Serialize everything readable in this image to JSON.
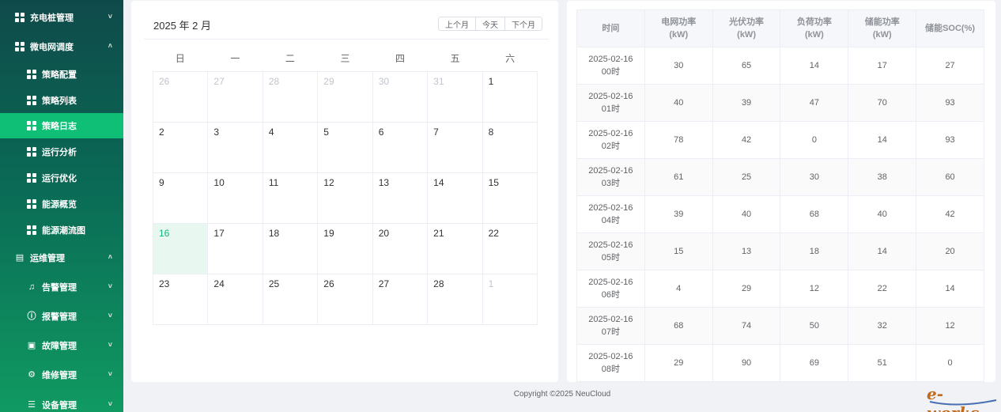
{
  "sidebar": {
    "items": [
      {
        "label": "充电桩管理",
        "level": 1,
        "icon": "grid-icon",
        "chevron": "˅"
      },
      {
        "label": "微电网调度",
        "level": 1,
        "icon": "grid-icon",
        "chevron": "˄"
      },
      {
        "label": "策略配置",
        "level": 2,
        "icon": "grid-icon",
        "chevron": ""
      },
      {
        "label": "策略列表",
        "level": 2,
        "icon": "grid-icon",
        "chevron": ""
      },
      {
        "label": "策略日志",
        "level": 2,
        "icon": "grid-icon",
        "chevron": "",
        "active": true
      },
      {
        "label": "运行分析",
        "level": 2,
        "icon": "grid-icon",
        "chevron": ""
      },
      {
        "label": "运行优化",
        "level": 2,
        "icon": "grid-icon",
        "chevron": ""
      },
      {
        "label": "能源概览",
        "level": 2,
        "icon": "grid-icon",
        "chevron": ""
      },
      {
        "label": "能源潮流图",
        "level": 2,
        "icon": "grid-icon",
        "chevron": ""
      },
      {
        "label": "运维管理",
        "level": 1,
        "icon": "document-icon",
        "chevron": "˄"
      },
      {
        "label": "告警管理",
        "level": 2,
        "icon": "bell-icon",
        "chevron": "˅"
      },
      {
        "label": "报警管理",
        "level": 2,
        "icon": "alert-circle-icon",
        "chevron": "˅"
      },
      {
        "label": "故障管理",
        "level": 2,
        "icon": "image-icon",
        "chevron": "˅"
      },
      {
        "label": "维修管理",
        "level": 2,
        "icon": "gear-icon",
        "chevron": "˅"
      },
      {
        "label": "设备管理",
        "level": 2,
        "icon": "list-icon",
        "chevron": "˅"
      }
    ]
  },
  "calendar": {
    "title": "2025 年 2 月",
    "buttons": {
      "prev": "上个月",
      "today": "今天",
      "next": "下个月"
    },
    "weekdays": [
      "日",
      "一",
      "二",
      "三",
      "四",
      "五",
      "六"
    ],
    "days": [
      {
        "d": "26",
        "other": true
      },
      {
        "d": "27",
        "other": true
      },
      {
        "d": "28",
        "other": true
      },
      {
        "d": "29",
        "other": true
      },
      {
        "d": "30",
        "other": true
      },
      {
        "d": "31",
        "other": true
      },
      {
        "d": "1"
      },
      {
        "d": "2"
      },
      {
        "d": "3"
      },
      {
        "d": "4"
      },
      {
        "d": "5"
      },
      {
        "d": "6"
      },
      {
        "d": "7"
      },
      {
        "d": "8"
      },
      {
        "d": "9"
      },
      {
        "d": "10"
      },
      {
        "d": "11"
      },
      {
        "d": "12"
      },
      {
        "d": "13"
      },
      {
        "d": "14"
      },
      {
        "d": "15"
      },
      {
        "d": "16",
        "today": true
      },
      {
        "d": "17"
      },
      {
        "d": "18"
      },
      {
        "d": "19"
      },
      {
        "d": "20"
      },
      {
        "d": "21"
      },
      {
        "d": "22"
      },
      {
        "d": "23"
      },
      {
        "d": "24"
      },
      {
        "d": "25"
      },
      {
        "d": "26"
      },
      {
        "d": "27"
      },
      {
        "d": "28"
      },
      {
        "d": "1",
        "other": true
      }
    ]
  },
  "table": {
    "headers": [
      "时间",
      "电网功率\n(kW)",
      "光伏功率\n(kW)",
      "负荷功率\n(kW)",
      "储能功率\n(kW)",
      "储能SOC(%)"
    ],
    "rows": [
      [
        "2025-02-16\n00时",
        "30",
        "65",
        "14",
        "17",
        "27"
      ],
      [
        "2025-02-16\n01时",
        "40",
        "39",
        "47",
        "70",
        "93"
      ],
      [
        "2025-02-16\n02时",
        "78",
        "42",
        "0",
        "14",
        "93"
      ],
      [
        "2025-02-16\n03时",
        "61",
        "25",
        "30",
        "38",
        "60"
      ],
      [
        "2025-02-16\n04时",
        "39",
        "40",
        "68",
        "40",
        "42"
      ],
      [
        "2025-02-16\n05时",
        "15",
        "13",
        "18",
        "14",
        "20"
      ],
      [
        "2025-02-16\n06时",
        "4",
        "29",
        "12",
        "22",
        "14"
      ],
      [
        "2025-02-16\n07时",
        "68",
        "74",
        "50",
        "32",
        "12"
      ],
      [
        "2025-02-16\n08时",
        "29",
        "90",
        "69",
        "51",
        "0"
      ]
    ]
  },
  "footer": {
    "copyright": "Copyright  ©2025  NeuCloud"
  },
  "watermark": {
    "text": "e-works"
  }
}
